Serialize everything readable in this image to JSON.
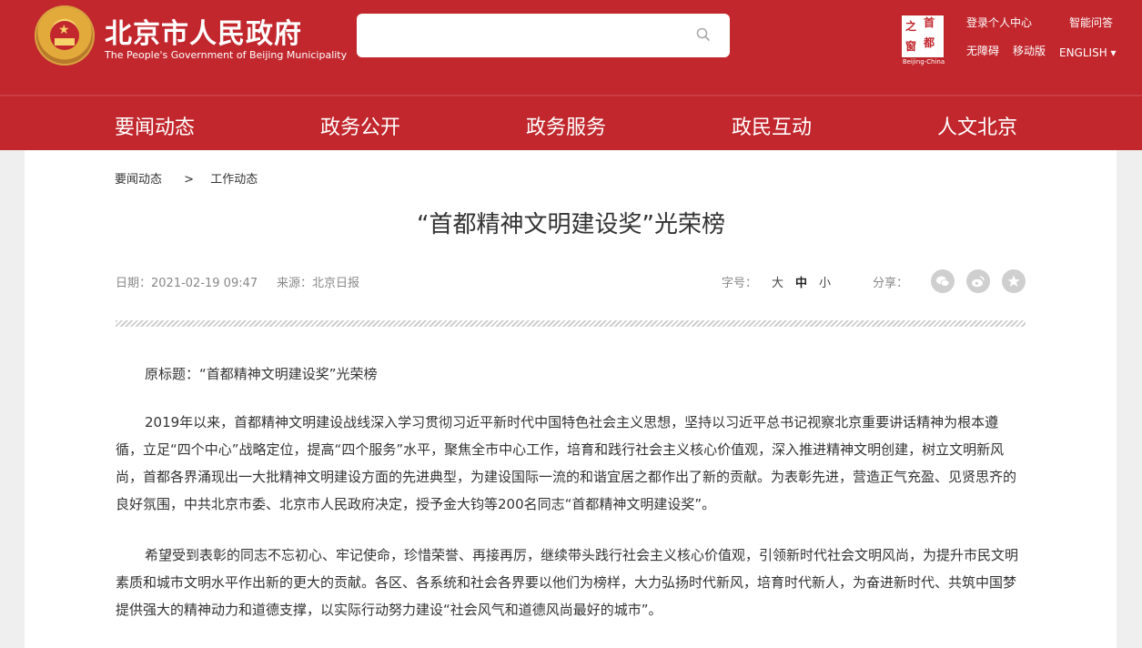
{
  "header": {
    "site_title": "北京市人民政府",
    "site_subtitle": "The People's Government of Beijing Municipality",
    "search": {
      "placeholder": ""
    },
    "logo": {
      "chars": [
        "之",
        "首",
        "窗",
        "都"
      ],
      "caption": "Beijing-China"
    },
    "links": {
      "login": "登录个人中心",
      "assistant": "智能问答",
      "accessibility": "无障碍",
      "mobile": "移动版",
      "english": "ENGLISH ▾"
    },
    "brand_color": "#c1272d"
  },
  "nav": {
    "items": [
      "要闻动态",
      "政务公开",
      "政务服务",
      "政民互动",
      "人文北京"
    ]
  },
  "breadcrumb": {
    "level1": "要闻动态",
    "separator": ">",
    "level2": "工作动态"
  },
  "article": {
    "title": "“首都精神文明建设奖”光荣榜",
    "date": "日期：2021-02-19 09:47",
    "source": "来源：北京日报",
    "font_size_label": "字号：",
    "font_sizes": {
      "large": "大",
      "medium": "中",
      "small": "小"
    },
    "share_label": "分享：",
    "share_icons": [
      "wechat-icon",
      "weibo-icon",
      "favorite-icon"
    ],
    "paragraphs": [
      "原标题：“首都精神文明建设奖”光荣榜",
      "2019年以来，首都精神文明建设战线深入学习贯彻习近平新时代中国特色社会主义思想，坚持以习近平总书记视察北京重要讲话精神为根本遵循，立足“四个中心”战略定位，提高“四个服务”水平，聚焦全市中心工作，培育和践行社会主义核心价值观，深入推进精神文明创建，树立文明新风尚，首都各界涌现出一大批精神文明建设方面的先进典型，为建设国际一流的和谐宜居之都作出了新的贡献。为表彰先进，营造正气充盈、见贤思齐的良好氛围，中共北京市委、北京市人民政府决定，授予金大钧等200名同志“首都精神文明建设奖”。",
      "希望受到表彰的同志不忘初心、牢记使命，珍惜荣誉、再接再厉，继续带头践行社会主义核心价值观，引领新时代社会文明风尚，为提升市民文明素质和城市文明水平作出新的更大的贡献。各区、各系统和社会各界要以他们为榜样，大力弘扬时代新风，培育时代新人，为奋进新时代、共筑中国梦提供强大的精神动力和道德支撑，以实际行动努力建设“社会风气和道德风尚最好的城市”。"
    ]
  }
}
